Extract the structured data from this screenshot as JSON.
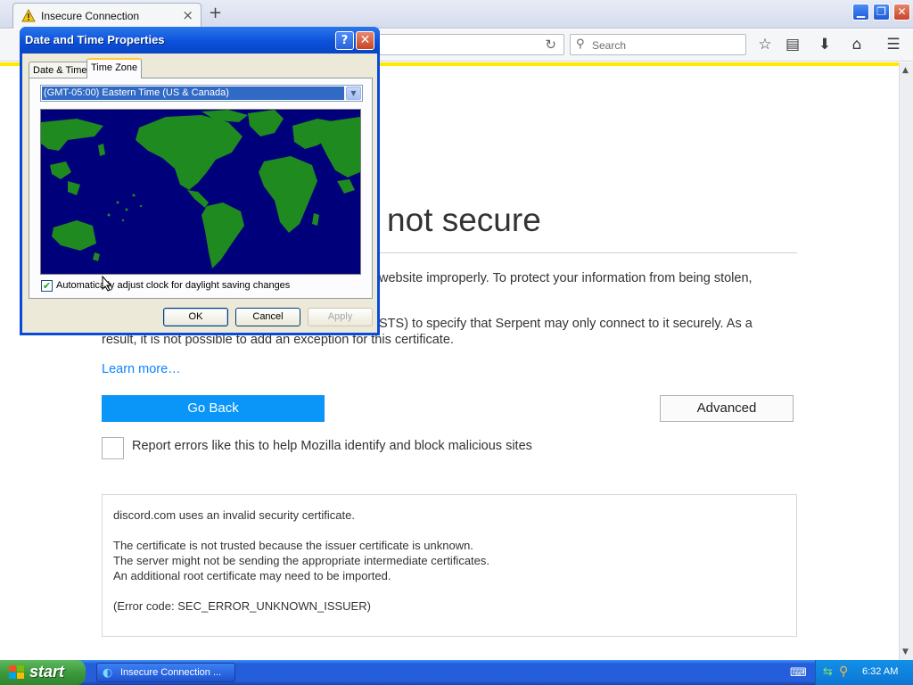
{
  "browser": {
    "tab_title": "Insecure Connection",
    "tab_close": "×",
    "new_tab": "+",
    "search_placeholder": "Search",
    "window_buttons": {
      "minimize": "▁",
      "restore": "❐",
      "close": "✕"
    }
  },
  "page": {
    "heading": "not secure",
    "para1": "website improperly. To protect your information from being stolen,",
    "para2a": "STS) to specify that Serpent may only connect to it securely. As a",
    "para2b": "result, it is not possible to add an exception for this certificate.",
    "learn_more": "Learn more…",
    "go_back": "Go Back",
    "advanced": "Advanced",
    "report_label": "Report errors like this to help Mozilla identify and block malicious sites",
    "details": {
      "line1": "discord.com uses an invalid security certificate.",
      "line2": "The certificate is not trusted because the issuer certificate is unknown.",
      "line3": "The server might not be sending the appropriate intermediate certificates.",
      "line4": "An additional root certificate may need to be imported.",
      "line5": "(Error code: SEC_ERROR_UNKNOWN_ISSUER)"
    }
  },
  "dialog": {
    "title": "Date and Time Properties",
    "help": "?",
    "close": "✕",
    "tabs": [
      "Date & Time",
      "Time Zone"
    ],
    "timezone": "(GMT-05:00) Eastern Time (US & Canada)",
    "dst_label": "Automatically adjust clock for daylight saving changes",
    "dst_checked": true,
    "ok": "OK",
    "cancel": "Cancel",
    "apply": "Apply"
  },
  "taskbar": {
    "start": "start",
    "task_item": "Insecure Connection ...",
    "clock": "6:32 AM"
  },
  "colors": {
    "accent_blue": "#0996f8",
    "warning_yellow": "#ffe900",
    "xp_title_blue": "#0a4fd8",
    "map_ocean": "#00007a",
    "map_land": "#1f8a1f"
  },
  "icons": {
    "tab": "warning-icon",
    "nav": [
      "bookmark-star-icon",
      "reading-list-icon",
      "download-icon",
      "home-icon",
      "menu-icon"
    ]
  }
}
